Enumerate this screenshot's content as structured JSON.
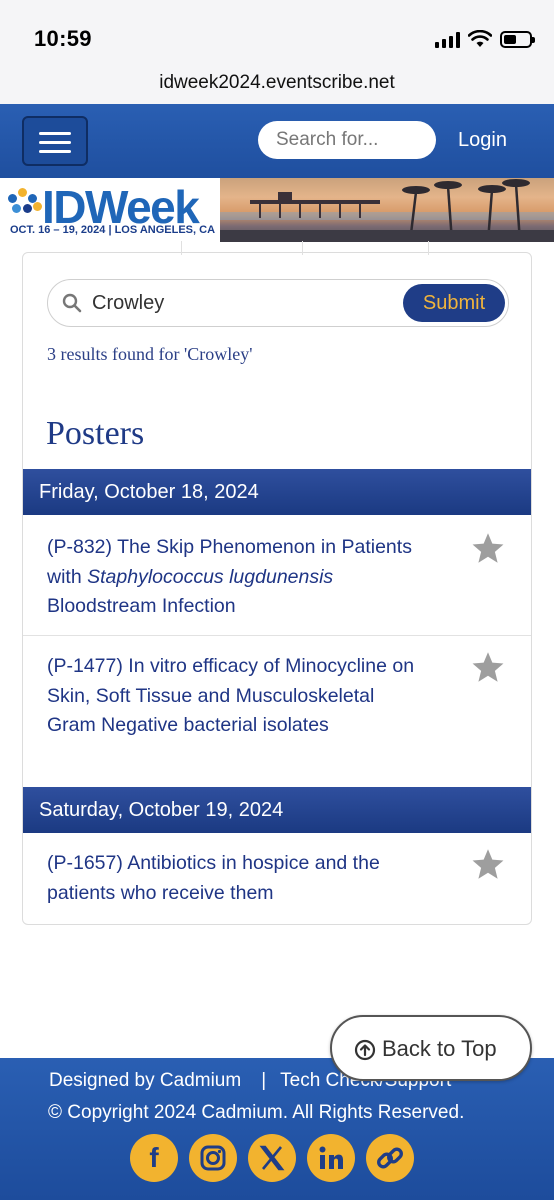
{
  "status_bar": {
    "time": "10:59"
  },
  "browser": {
    "url": "idweek2024.eventscribe.net"
  },
  "header": {
    "search_placeholder": "Search for...",
    "login_label": "Login"
  },
  "banner": {
    "logo_text": "IDWeek",
    "logo_sub": "OCT. 16 – 19, 2024 | LOS ANGELES, CA"
  },
  "results": {
    "query": "Crowley",
    "submit_label": "Submit",
    "count_text": "3 results found for 'Crowley'",
    "section_title": "Posters",
    "days": [
      {
        "label": "Friday, October 18, 2024"
      },
      {
        "label": "Saturday, October 19, 2024"
      }
    ],
    "posters": [
      {
        "prefix": "(P-832) The Skip Phenomenon in Patients with ",
        "italic": "Staphylococcus lugdunensis",
        "suffix": " Bloodstream Infection"
      },
      {
        "prefix": "(P-1477) In vitro efficacy of Minocycline on Skin, Soft Tissue and Musculoskeletal Gram Negative bacterial isolates",
        "italic": "",
        "suffix": ""
      },
      {
        "prefix": "(P-1657) Antibiotics in hospice and the patients who receive them",
        "italic": "",
        "suffix": ""
      }
    ]
  },
  "back_to_top": {
    "label": "Back to Top"
  },
  "footer": {
    "designed_by": "Designed by Cadmium",
    "separator": "|",
    "tech_check": "Tech Check/Support",
    "copyright": "© Copyright 2024 Cadmium. All Rights Reserved.",
    "socials": [
      "facebook-icon",
      "instagram-icon",
      "x-icon",
      "linkedin-icon",
      "link-icon"
    ]
  },
  "colors": {
    "header_blue": "#2a5fb3",
    "navy": "#1f3d87",
    "accent_gold": "#f2b32f",
    "star_gray": "#9e9e9e"
  }
}
